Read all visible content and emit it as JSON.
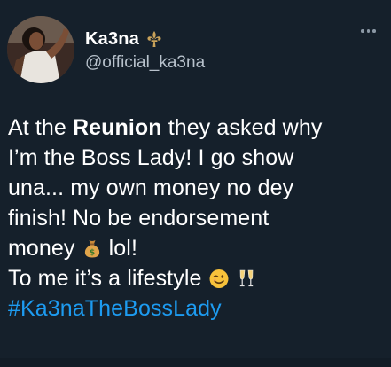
{
  "user": {
    "display_name": "Ka3na",
    "handle": "@official_ka3na",
    "badge_icon": "fleur-de-lis-icon",
    "badge_color": "#c9a25a"
  },
  "menu": {
    "more_icon": "more-options-icon"
  },
  "tweet": {
    "l1_pre": "At the ",
    "l1_bold": "Reunion",
    "l1_post": " they asked why",
    "l2": "I’m the Boss Lady! I go show",
    "l3": "una... my own money no dey",
    "l4": "finish! No be endorsement",
    "l5_pre": "money ",
    "l5_post": " lol!",
    "l6_pre": "To me it’s a lifestyle ",
    "hashtag": "#Ka3naTheBossLady",
    "emojis": [
      "money-bag-emoji",
      "winking-face-emoji",
      "clinking-glasses-emoji"
    ]
  },
  "colors": {
    "background": "#15202b",
    "text": "#ffffff",
    "secondary": "#b8c2cc",
    "link": "#1d9bf0"
  }
}
